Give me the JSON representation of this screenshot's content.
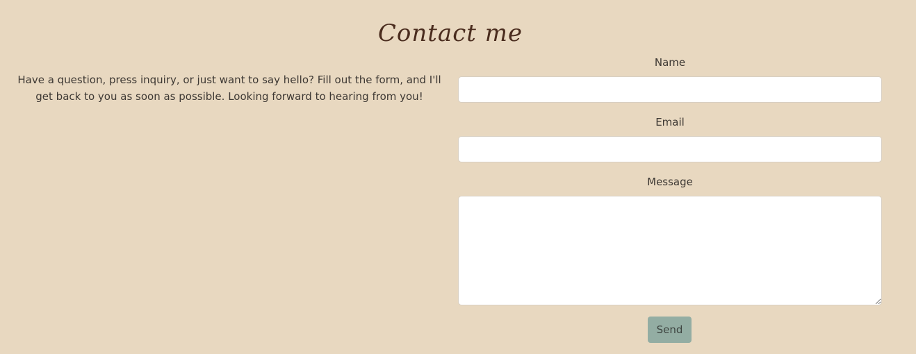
{
  "page": {
    "title": "Contact me",
    "intro": "Have a question, press inquiry, or just want to say hello? Fill out the form, and I'll get back to you as soon as possible. Looking forward to hearing from you!"
  },
  "form": {
    "name": {
      "label": "Name",
      "value": "",
      "placeholder": ""
    },
    "email": {
      "label": "Email",
      "value": "",
      "placeholder": ""
    },
    "message": {
      "label": "Message",
      "value": "",
      "placeholder": ""
    },
    "send_label": "Send"
  },
  "colors": {
    "background": "#e8d8c0",
    "title": "#4a2c1e",
    "button": "#93ada3",
    "input_background": "#ffffff"
  }
}
